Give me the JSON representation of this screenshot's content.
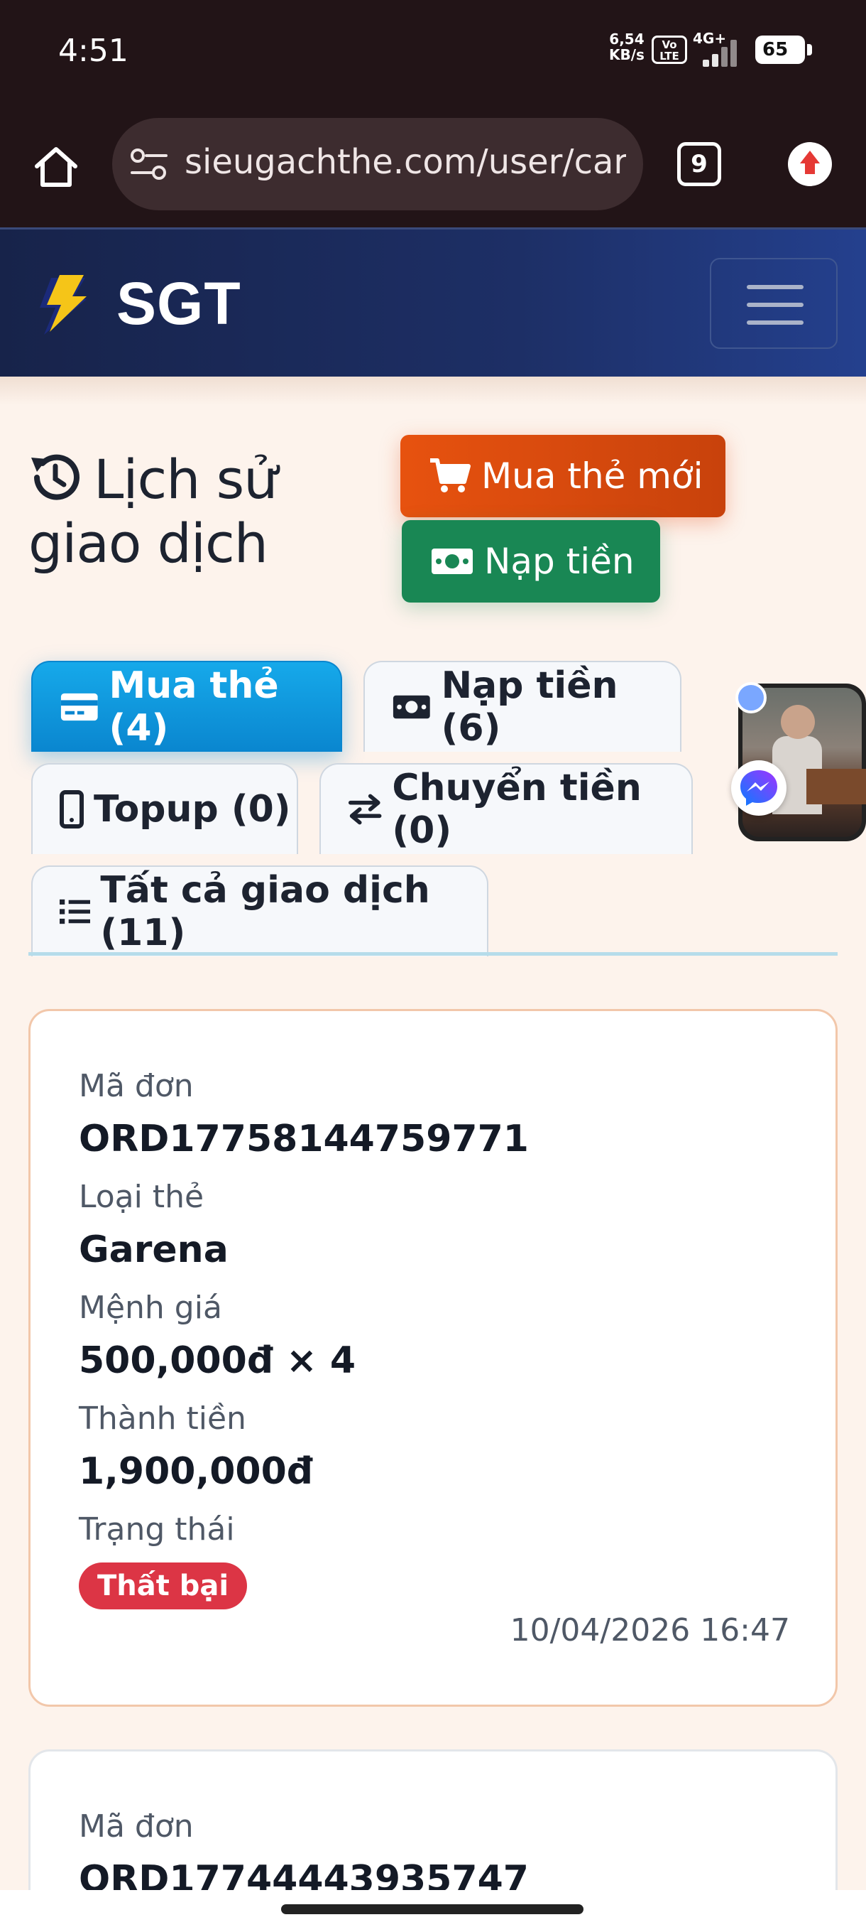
{
  "status_bar": {
    "time": "4:51",
    "speed_value": "6,54",
    "speed_unit": "KB/s",
    "volte": "Vo LTE",
    "network": "4G+",
    "battery": "65"
  },
  "browser": {
    "url": "sieugachthe.com/user/card",
    "tab_count": "9"
  },
  "header": {
    "brand": "SGT"
  },
  "page": {
    "title_line1": "Lịch sử",
    "title_line2": "giao dịch",
    "buy_button": "Mua thẻ mới",
    "topup_button": "Nạp tiền"
  },
  "tabs": [
    {
      "label": "Mua thẻ (4)",
      "icon": "credit-card-icon",
      "active": true
    },
    {
      "label": "Nạp tiền (6)",
      "icon": "money-icon",
      "active": false
    },
    {
      "label": "Topup (0)",
      "icon": "mobile-icon",
      "active": false
    },
    {
      "label": "Chuyển tiền (0)",
      "icon": "exchange-icon",
      "active": false
    },
    {
      "label": "Tất cả giao dịch (11)",
      "icon": "list-icon",
      "active": false
    }
  ],
  "orders": [
    {
      "order_label": "Mã đơn",
      "order_id": "ORD17758144759771",
      "card_type_label": "Loại thẻ",
      "card_type": "Garena",
      "denomination_label": "Mệnh giá",
      "denomination": "500,000đ × 4",
      "total_label": "Thành tiền",
      "total": "1,900,000đ",
      "status_label": "Trạng thái",
      "status": "Thất bại",
      "status_color": "#dc3545",
      "datetime": "10/04/2026 16:47"
    },
    {
      "order_label": "Mã đơn",
      "order_id": "ORD17744443935747"
    }
  ],
  "colors": {
    "header_bg": "#1d2f66",
    "buy_button": "#e7520f",
    "topup_button": "#198754",
    "active_tab": "#0a86cf",
    "page_bg": "#fdf3ec"
  }
}
